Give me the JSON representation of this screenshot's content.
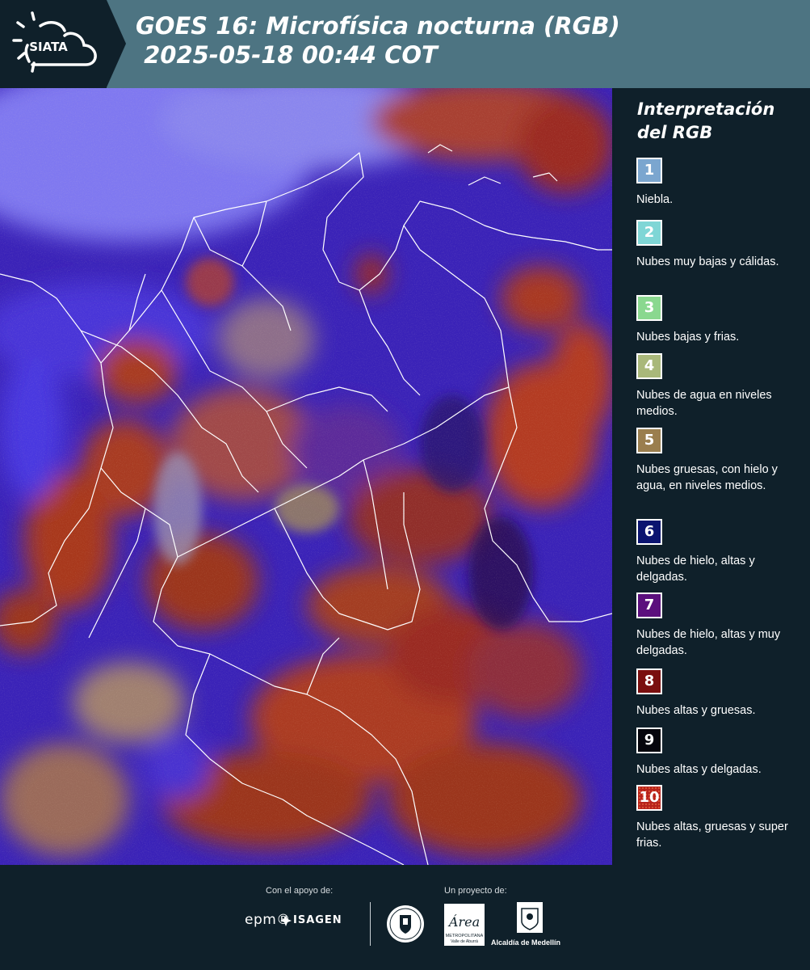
{
  "header": {
    "logo_text": "SIATA",
    "title": "GOES 16: Microfísica nocturna (RGB)\n 2025-05-18 00:44 COT"
  },
  "legend": {
    "title": "Interpretación\ndel RGB",
    "items": [
      {
        "num": "1",
        "label": "Niebla.",
        "color": "#7ba6cf"
      },
      {
        "num": "2",
        "label": "Nubes muy bajas y cálidas.",
        "color": "#7fd6d6"
      },
      {
        "num": "3",
        "label": "Nubes bajas y frias.",
        "color": "#8ad88f"
      },
      {
        "num": "4",
        "label": "Nubes de agua en niveles medios.",
        "color": "#a9b87a"
      },
      {
        "num": "5",
        "label": "Nubes gruesas, con hielo y agua, en niveles medios.",
        "color": "#9a7e4e"
      },
      {
        "num": "6",
        "label": "Nubes de hielo, altas y delgadas.",
        "color": "#0b1470"
      },
      {
        "num": "7",
        "label": "Nubes de hielo, altas y muy delgadas.",
        "color": "#5b0f7d"
      },
      {
        "num": "8",
        "label": "Nubes altas y gruesas.",
        "color": "#7a0f0f"
      },
      {
        "num": "9",
        "label": "Nubes altas y delgadas.",
        "color": "#05050c"
      },
      {
        "num": "10",
        "label": "Nubes altas, gruesas y super frias.",
        "color": "#b8231c"
      }
    ]
  },
  "footer": {
    "support_label": "Con el apoyo de:",
    "project_label": "Un proyecto de:",
    "epm": "epm®",
    "isagen": "ISAGEN",
    "area_logo_text": "Área",
    "area_sub": "METROPOLITANA",
    "area_sub2": "Valle de Aburrá",
    "alcaldia": "Alcaldía de Medellín"
  }
}
